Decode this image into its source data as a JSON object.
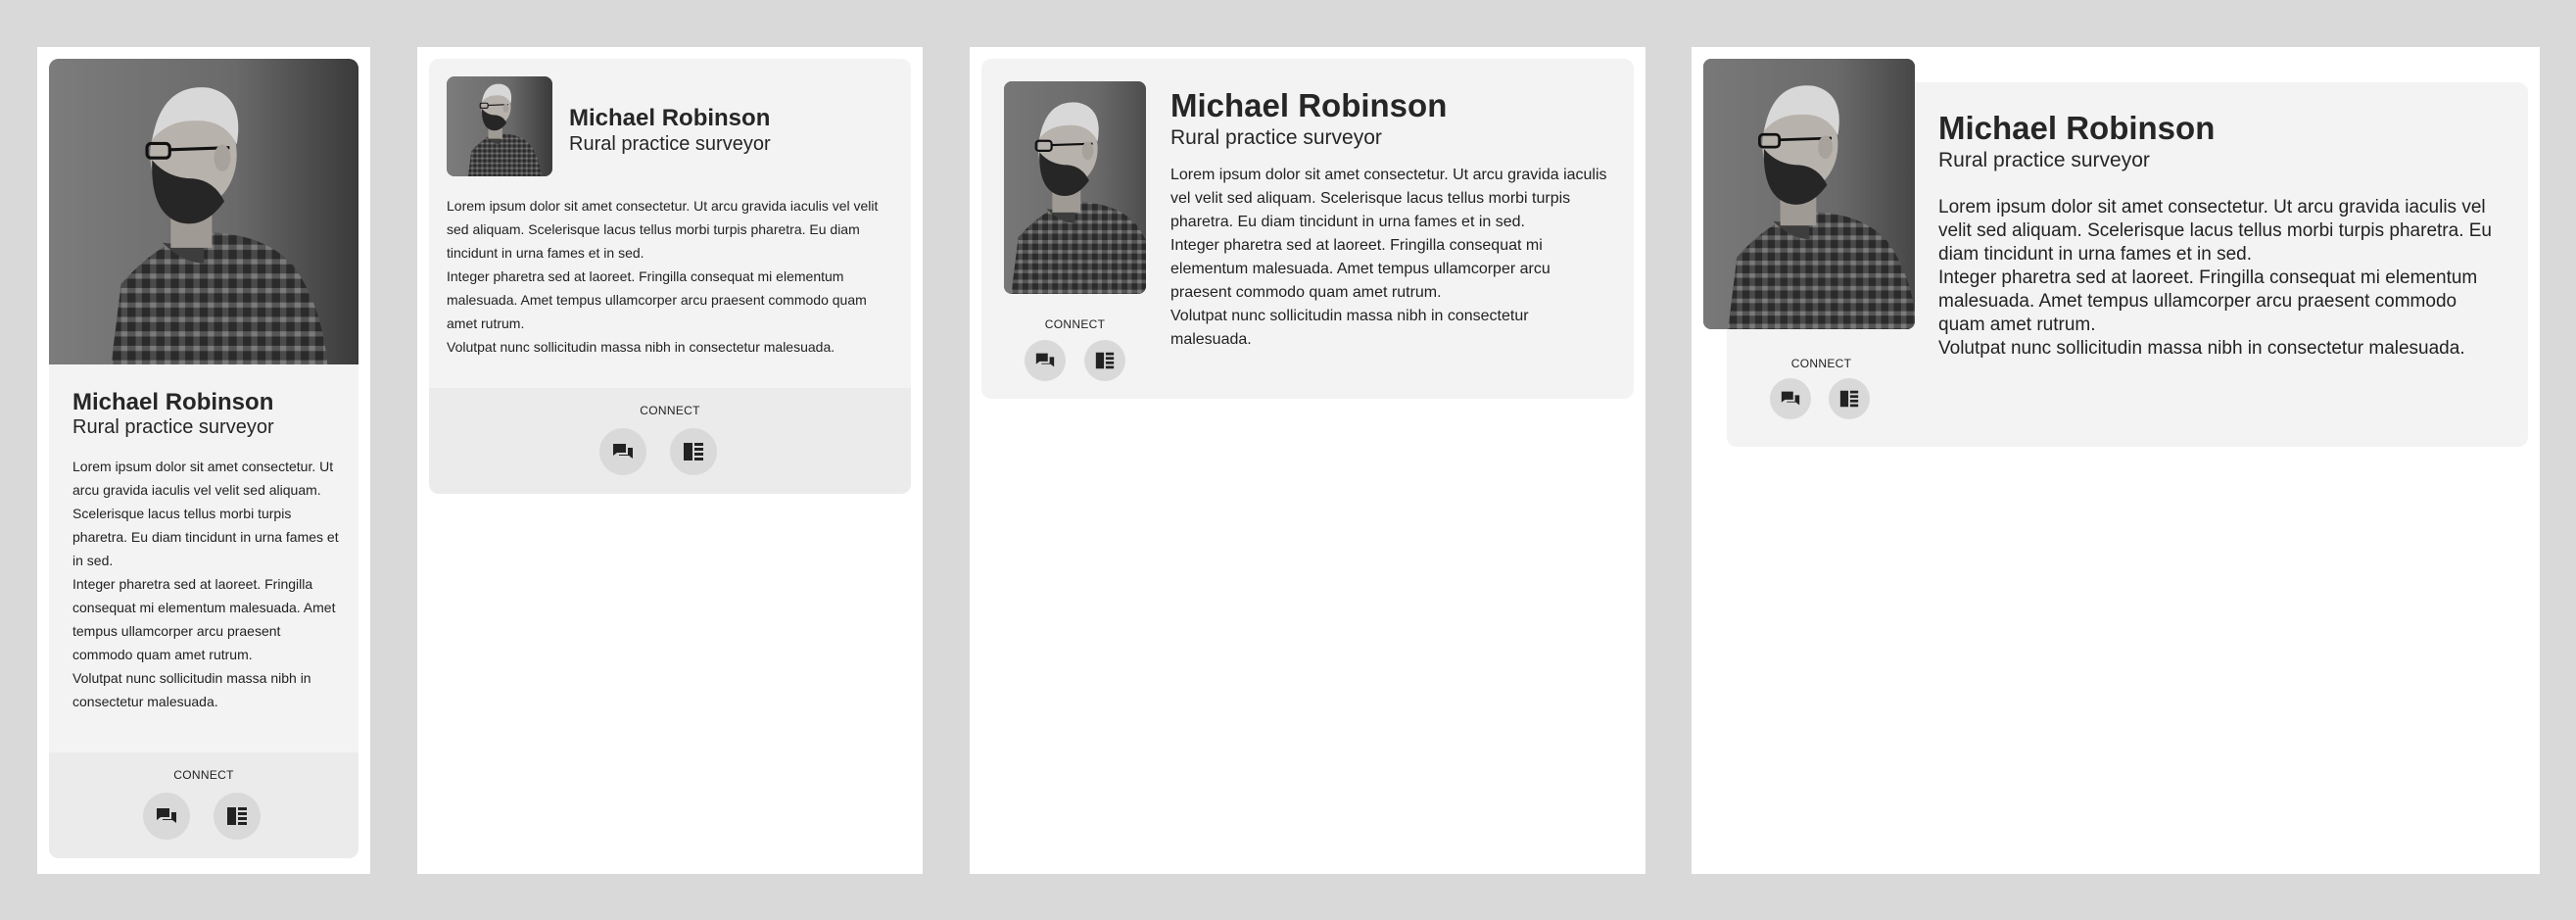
{
  "profile": {
    "name": "Michael Robinson",
    "role": "Rural practice surveyor",
    "bio": [
      "Lorem ipsum dolor sit amet consectetur. Ut arcu gravida iaculis vel velit sed aliquam. Scelerisque lacus tellus morbi turpis pharetra. Eu diam tincidunt in urna fames et in sed.",
      "Integer pharetra sed at laoreet. Fringilla consequat mi elementum malesuada. Amet tempus ullamcorper arcu praesent commodo quam amet rutrum.",
      "Volutpat nunc sollicitudin massa nibh in consectetur malesuada."
    ],
    "connect_label": "CONNECT",
    "photo_alt": "Portrait of Michael Robinson"
  },
  "icons": {
    "chat": "chat-bubbles-icon",
    "profile": "profile-card-icon"
  },
  "colors": {
    "page_background": "#d9d9d9",
    "panel_background": "#ffffff",
    "card_background": "#f3f3f3",
    "footer_background": "#ebebeb",
    "icon_button_background": "#d9d9d9",
    "text": "#262626"
  }
}
